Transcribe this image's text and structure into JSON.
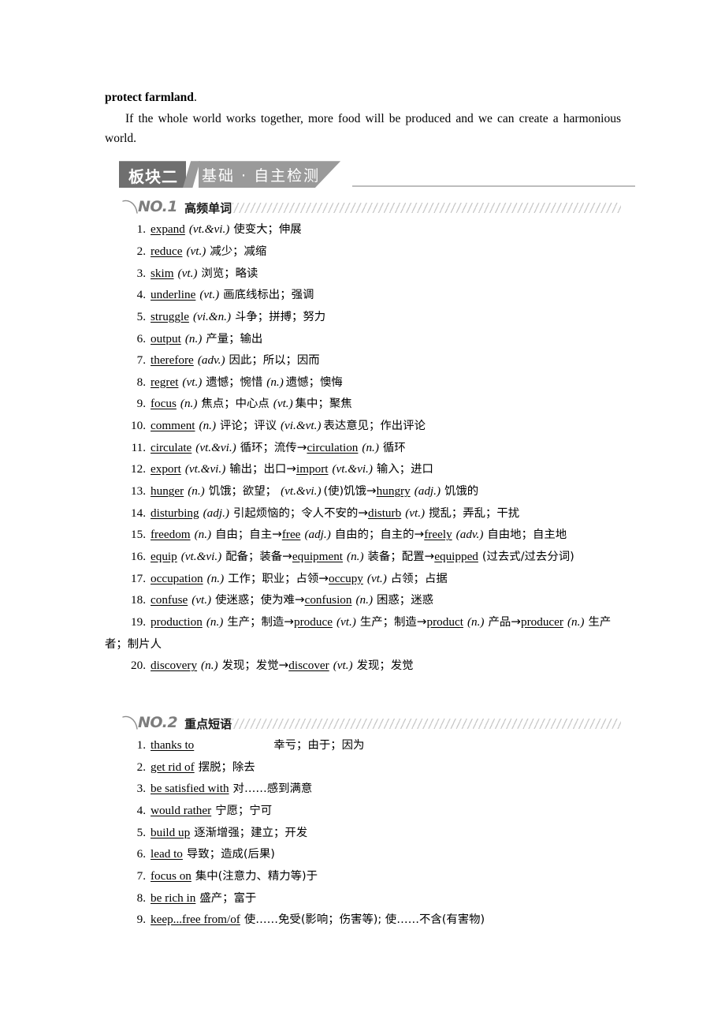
{
  "intro": {
    "bold_lead": "protect farmland",
    "bold_lead_tail": ".",
    "paragraph": "If the whole world works together, more food will be produced and we can create a harmonious world."
  },
  "banner": {
    "number_label": "板块二",
    "title_label": "基础 · 自主检测",
    "dark_color": "#6f6f6f",
    "light_color": "#9a9a9a",
    "rule_color": "#bdbdbd"
  },
  "sections": [
    {
      "no_label": "NO.1",
      "title": "高频单词",
      "entries": [
        {
          "idx": "1.",
          "word": "expand",
          "pos": "(vt.&vi.)",
          "cn": "使变大；伸展"
        },
        {
          "idx": "2.",
          "word": "reduce",
          "pos": "(vt.)",
          "cn": "减少；减缩"
        },
        {
          "idx": "3.",
          "word": "skim",
          "pos": "(vt.)",
          "cn": "浏览；略读"
        },
        {
          "idx": "4.",
          "word": "underline",
          "pos": "(vt.)",
          "cn": "画底线标出；强调"
        },
        {
          "idx": "5.",
          "word": "struggle",
          "pos": "(vi.&n.)",
          "cn": "斗争；拼搏；努力"
        },
        {
          "idx": "6.",
          "word": "output",
          "pos": "(n.)",
          "cn": "产量；输出"
        },
        {
          "idx": "7.",
          "word": "therefore",
          "pos": "(adv.)",
          "cn": "因此；所以；因而"
        },
        {
          "idx": "8.",
          "word": "regret",
          "pos": "(vt.)",
          "cn": "遗憾；惋惜",
          "pos2": "(n.)",
          "cn2": "遗憾；懊悔"
        },
        {
          "idx": "9.",
          "word": "focus",
          "pos": "(n.)",
          "cn": "焦点；中心点",
          "pos2": "(vt.)",
          "cn2": "集中；聚焦"
        },
        {
          "idx": "10.",
          "word": "comment",
          "pos": "(n.)",
          "cn": "评论；评议",
          "pos2": "(vi.&vt.)",
          "cn2": "表达意见；作出评论"
        },
        {
          "idx": "11.",
          "word": "circulate",
          "pos": "(vt.&vi.)",
          "cn": "循环；流传",
          "arrow": "→",
          "word2": "circulation",
          "pos3": "(n.)",
          "cn3": "循环"
        },
        {
          "idx": "12.",
          "word": "export",
          "pos": "(vt.&vi.)",
          "cn": "输出；出口",
          "arrow": "→",
          "word2": "import",
          "pos3": "(vt.&vi.)",
          "cn3": "输入；进口"
        },
        {
          "idx": "13.",
          "word": "hunger",
          "pos": "(n.)",
          "cn": "饥饿；欲望；",
          "pos2": "(vt.&vi.)",
          "cn2": "(使)饥饿",
          "arrow": "→",
          "word2": "hungry",
          "pos3": "(adj.)",
          "cn3": "饥饿的"
        },
        {
          "idx": "14.",
          "word": "disturbing",
          "pos": "(adj.)",
          "cn": "引起烦恼的；令人不安的",
          "arrow": "→",
          "word2": "disturb",
          "pos3": "(vt.)",
          "cn3": "搅乱；弄乱；干扰"
        },
        {
          "idx": "15.",
          "word": "freedom",
          "pos": "(n.)",
          "cn": "自由；自主",
          "arrow": "→",
          "word2": "free",
          "pos3": "(adj.)",
          "cn3": "自由的；自主的",
          "arrow2": "→",
          "word3": "freely",
          "pos4": "(adv.)",
          "cn4": "自由地；自主地"
        },
        {
          "idx": "16.",
          "word": "equip",
          "pos": "(vt.&vi.)",
          "cn": "配备；装备",
          "arrow": "→",
          "word2": "equipment",
          "pos3": "(n.)",
          "cn3": "装备；配置",
          "arrow2": "→",
          "word3": "equipped",
          "cn4": "(过去式/过去分词)"
        },
        {
          "idx": "17.",
          "word": "occupation",
          "pos": "(n.)",
          "cn": "工作；职业；占领",
          "arrow": "→",
          "word2": "occupy",
          "pos3": "(vt.)",
          "cn3": "占领；占据"
        },
        {
          "idx": "18.",
          "word": "confuse",
          "pos": "(vt.)",
          "cn": "使迷惑；使为难",
          "arrow": "→",
          "word2": "confusion",
          "pos3": "(n.)",
          "cn3": "困惑；迷惑"
        },
        {
          "idx": "19.",
          "word": "production",
          "pos": "(n.)",
          "cn": "生产；制造",
          "arrow": "→",
          "word2": "produce",
          "pos3": "(vt.)",
          "cn3": "生产；制造",
          "arrow2": "→",
          "word3": "product",
          "pos4": "(n.)",
          "cn4": "产品",
          "arrow3": "→",
          "word4": "producer",
          "pos5": "(n.)",
          "cn5": "生产者；制片人"
        },
        {
          "idx": "20.",
          "word": "discovery",
          "pos": "(n.)",
          "cn": "发现；发觉",
          "arrow": "→",
          "word2": "discover",
          "pos3": "(vt.)",
          "cn3": "发现；发觉"
        }
      ]
    },
    {
      "no_label": "NO.2",
      "title": "重点短语",
      "entries": [
        {
          "idx": "1.",
          "word": "thanks to",
          "cn": "幸亏；由于；因为",
          "wide_gap": true
        },
        {
          "idx": "2.",
          "word": "get rid of",
          "cn": "摆脱；除去"
        },
        {
          "idx": "3.",
          "word": "be satisfied with",
          "cn": "对……感到满意"
        },
        {
          "idx": "4.",
          "word": "would rather",
          "cn": "宁愿；宁可"
        },
        {
          "idx": "5.",
          "word": "build up",
          "cn": "逐渐增强；建立；开发"
        },
        {
          "idx": "6.",
          "word": "lead to",
          "cn": "导致；造成(后果)"
        },
        {
          "idx": "7.",
          "word": "focus on",
          "cn": "集中(注意力、精力等)于"
        },
        {
          "idx": "8.",
          "word": "be rich in",
          "cn": "盛产；富于"
        },
        {
          "idx": "9.",
          "word": "keep...free from/of",
          "cn": "使……免受(影响；伤害等); 使……不含(有害物)"
        }
      ]
    }
  ]
}
